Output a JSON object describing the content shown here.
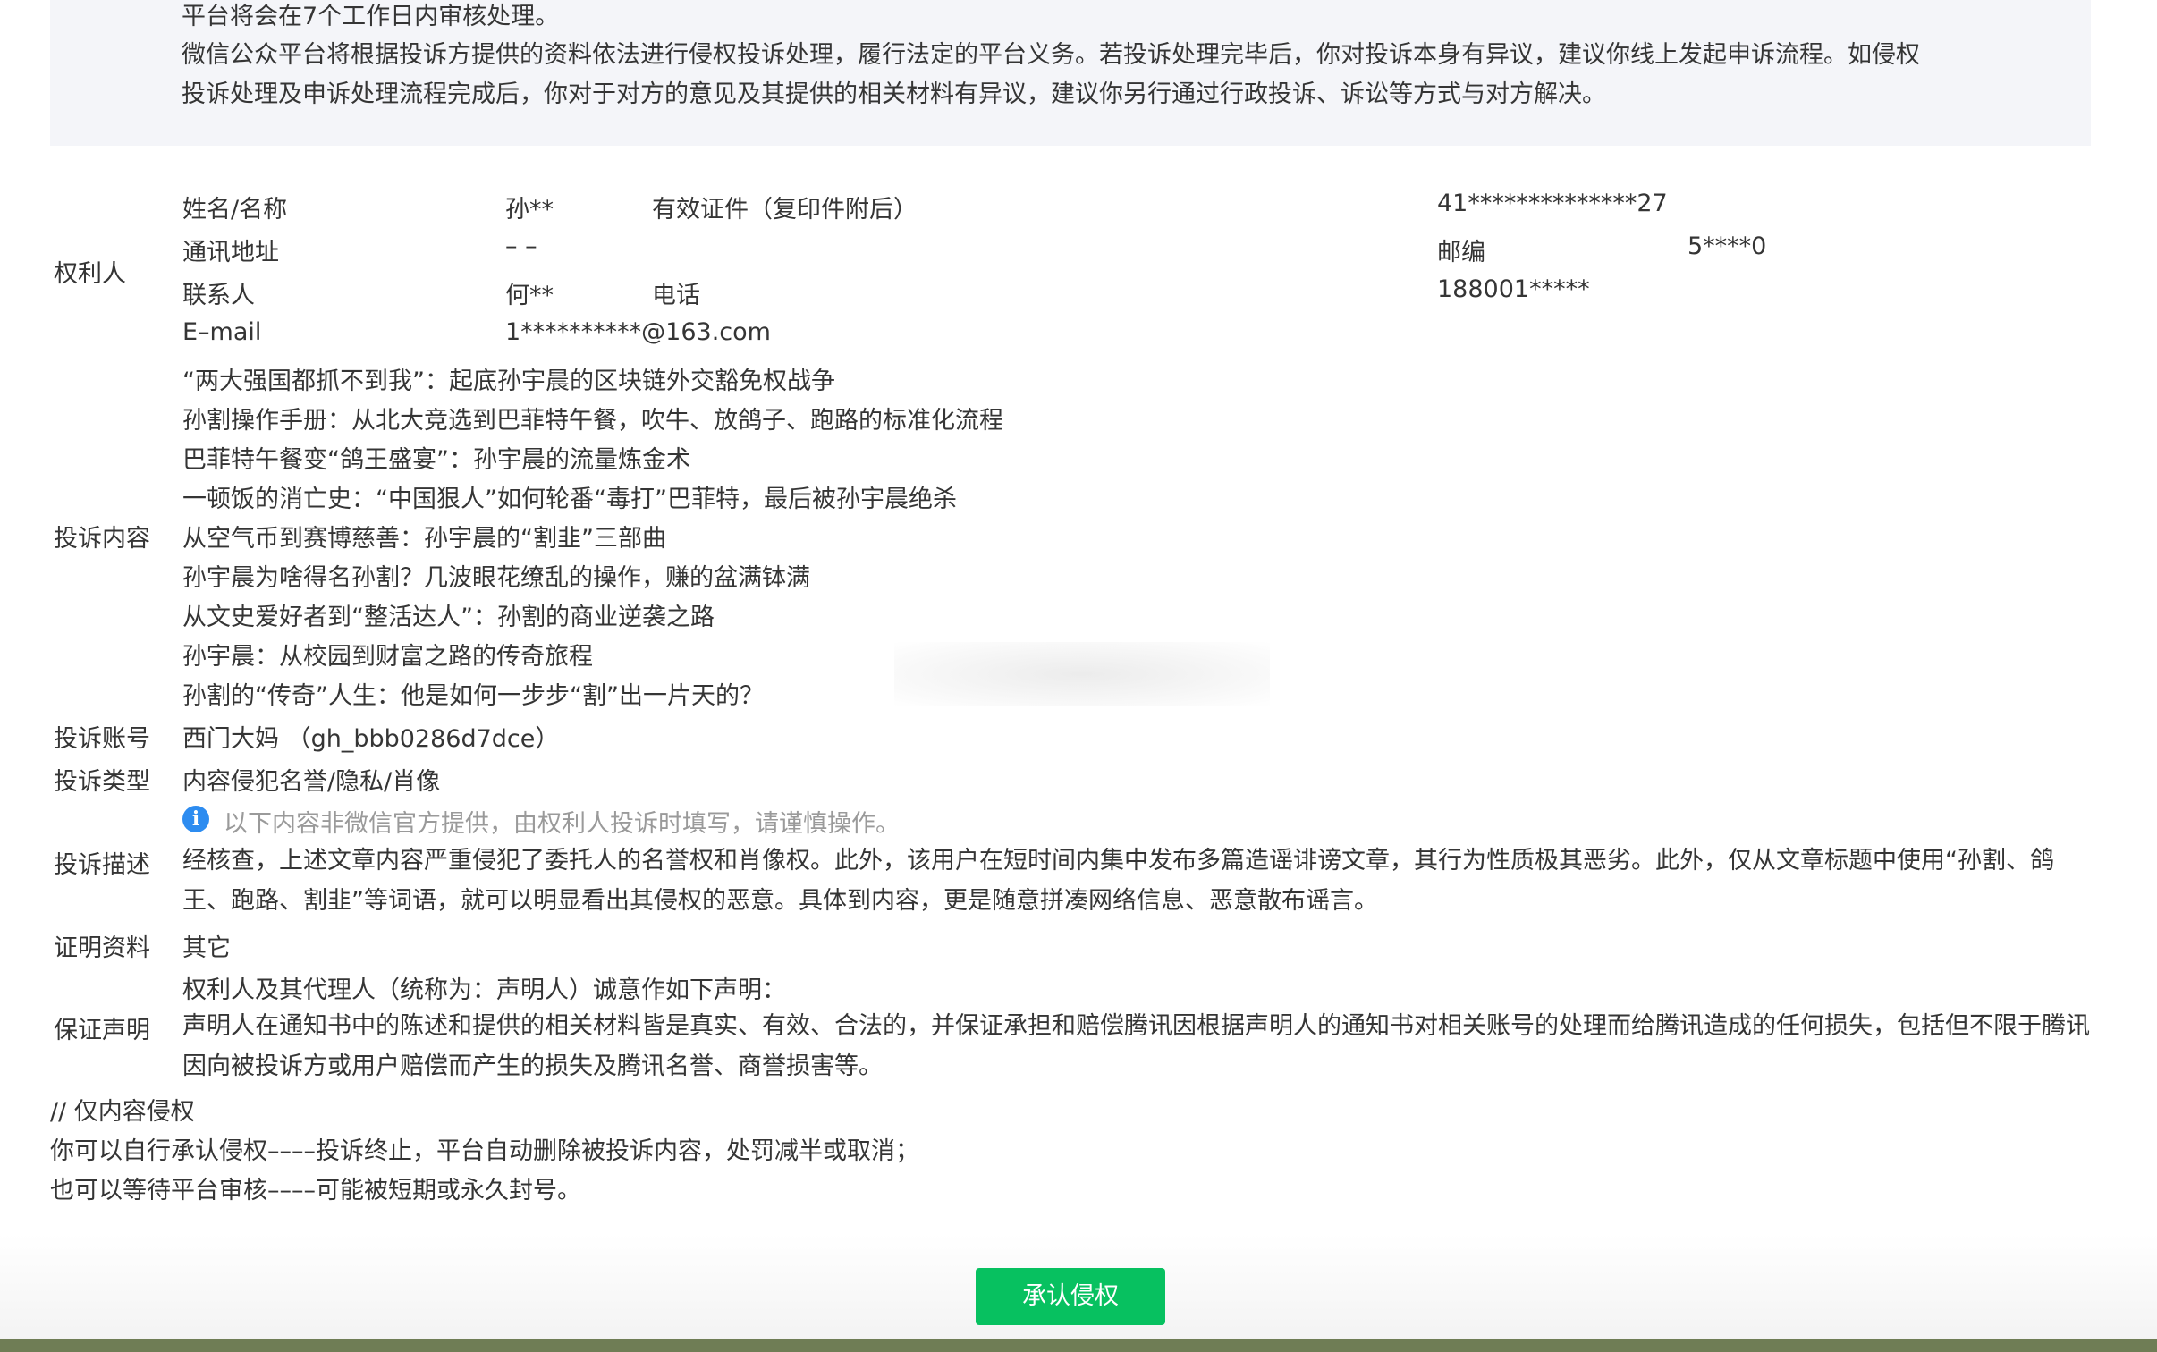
{
  "notice": {
    "line1": "平台将会在7个工作日内审核处理。",
    "line2": "微信公众平台将根据投诉方提供的资料依法进行侵权投诉处理，履行法定的平台义务。若投诉处理完毕后，你对投诉本身有异议，建议你线上发起申诉流程。如侵权",
    "line3": "投诉处理及申诉处理流程完成后，你对于对方的意见及其提供的相关材料有异议，建议你另行通过行政投诉、诉讼等方式与对方解决。"
  },
  "rights_holder": {
    "label": "权利人",
    "name_label": "姓名/名称",
    "name_value": "孙**",
    "id_label": "有效证件（复印件附后）",
    "id_value": "41**************27",
    "address_label": "通讯地址",
    "address_value": "– –",
    "zip_label": "邮编",
    "zip_value": "5****0",
    "contact_label": "联系人",
    "contact_value": "何**",
    "phone_label": "电话",
    "phone_value": "188001*****",
    "email_label": "E–mail",
    "email_value": "1**********@163.com"
  },
  "complaint_content": {
    "label": "投诉内容",
    "articles": [
      "“两大强国都抓不到我”：起底孙宇晨的区块链外交豁免权战争",
      "孙割操作手册：从北大竞选到巴菲特午餐，吹牛、放鸽子、跑路的标准化流程",
      "巴菲特午餐变“鸽王盛宴”：孙宇晨的流量炼金术",
      "一顿饭的消亡史：“中国狠人”如何轮番“毒打”巴菲特，最后被孙宇晨绝杀",
      "从空气币到赛博慈善：孙宇晨的“割韭”三部曲",
      "孙宇晨为啥得名孙割？几波眼花缭乱的操作，赚的盆满钵满",
      "从文史爱好者到“整活达人”：孙割的商业逆袭之路",
      "孙宇晨：从校园到财富之路的传奇旅程",
      "孙割的“传奇”人生：他是如何一步步“割”出一片天的？"
    ]
  },
  "complaint_account": {
    "label": "投诉账号",
    "value": "西门大妈 （gh_bbb0286d7dce）"
  },
  "complaint_type": {
    "label": "投诉类型",
    "value": "内容侵犯名誉/隐私/肖像"
  },
  "hint_text": "以下内容非微信官方提供，由权利人投诉时填写，请谨慎操作。",
  "complaint_desc": {
    "label": "投诉描述",
    "value": "经核查，上述文章内容严重侵犯了委托人的名誉权和肖像权。此外，该用户在短时间内集中发布多篇造谣诽谤文章，其行为性质极其恶劣。此外，仅从文章标题中使用“孙割、鸽王、跑路、割韭”等词语，就可以明显看出其侵权的恶意。具体到内容，更是随意拼凑网络信息、恶意散布谣言。"
  },
  "evidence": {
    "label": "证明资料",
    "value": "其它"
  },
  "guarantee": {
    "label": "保证声明",
    "intro": "权利人及其代理人（统称为：声明人）诚意作如下声明：",
    "body": "声明人在通知书中的陈述和提供的相关材料皆是真实、有效、合法的，并保证承担和赔偿腾讯因根据声明人的通知书对相关账号的处理而给腾讯造成的任何损失，包括但不限于腾讯因向被投诉方或用户赔偿而产生的损失及腾讯名誉、商誉损害等。"
  },
  "options": {
    "comment": "// 仅内容侵权",
    "line1": "你可以自行承认侵权––––投诉终止，平台自动删除被投诉内容，处罚减半或取消；",
    "line2": "也可以等待平台审核––––可能被短期或永久封号。"
  },
  "confirm_button": "承认侵权",
  "colors": {
    "accent_green": "#07c160",
    "info_blue": "#2d8cf0",
    "notice_bg": "#f4f5f9"
  }
}
